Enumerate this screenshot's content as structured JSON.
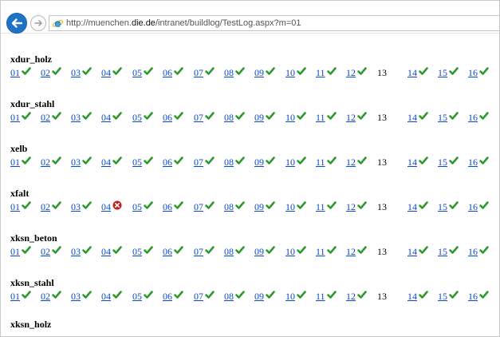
{
  "browser": {
    "url_prefix": "http://muenchen.",
    "url_host": "die.de",
    "url_suffix": "/intranet/buildlog/TestLog.aspx?m=01"
  },
  "groups": [
    {
      "name": "xdur_holz",
      "entries": [
        {
          "label": "01",
          "status": "ok"
        },
        {
          "label": "02",
          "status": "ok"
        },
        {
          "label": "03",
          "status": "ok"
        },
        {
          "label": "04",
          "status": "ok"
        },
        {
          "label": "05",
          "status": "ok"
        },
        {
          "label": "06",
          "status": "ok"
        },
        {
          "label": "07",
          "status": "ok"
        },
        {
          "label": "08",
          "status": "ok"
        },
        {
          "label": "09",
          "status": "ok"
        },
        {
          "label": "10",
          "status": "ok"
        },
        {
          "label": "11",
          "status": "ok"
        },
        {
          "label": "12",
          "status": "ok"
        },
        {
          "label": "13",
          "status": "none"
        },
        {
          "label": "14",
          "status": "ok"
        },
        {
          "label": "15",
          "status": "ok"
        },
        {
          "label": "16",
          "status": "ok"
        }
      ]
    },
    {
      "name": "xdur_stahl",
      "entries": [
        {
          "label": "01",
          "status": "ok"
        },
        {
          "label": "02",
          "status": "ok"
        },
        {
          "label": "03",
          "status": "ok"
        },
        {
          "label": "04",
          "status": "ok"
        },
        {
          "label": "05",
          "status": "ok"
        },
        {
          "label": "06",
          "status": "ok"
        },
        {
          "label": "07",
          "status": "ok"
        },
        {
          "label": "08",
          "status": "ok"
        },
        {
          "label": "09",
          "status": "ok"
        },
        {
          "label": "10",
          "status": "ok"
        },
        {
          "label": "11",
          "status": "ok"
        },
        {
          "label": "12",
          "status": "ok"
        },
        {
          "label": "13",
          "status": "none"
        },
        {
          "label": "14",
          "status": "ok"
        },
        {
          "label": "15",
          "status": "ok"
        },
        {
          "label": "16",
          "status": "ok"
        }
      ]
    },
    {
      "name": "xelb",
      "entries": [
        {
          "label": "01",
          "status": "ok"
        },
        {
          "label": "02",
          "status": "ok"
        },
        {
          "label": "03",
          "status": "ok"
        },
        {
          "label": "04",
          "status": "ok"
        },
        {
          "label": "05",
          "status": "ok"
        },
        {
          "label": "06",
          "status": "ok"
        },
        {
          "label": "07",
          "status": "ok"
        },
        {
          "label": "08",
          "status": "ok"
        },
        {
          "label": "09",
          "status": "ok"
        },
        {
          "label": "10",
          "status": "ok"
        },
        {
          "label": "11",
          "status": "ok"
        },
        {
          "label": "12",
          "status": "ok"
        },
        {
          "label": "13",
          "status": "none"
        },
        {
          "label": "14",
          "status": "ok"
        },
        {
          "label": "15",
          "status": "ok"
        },
        {
          "label": "16",
          "status": "ok"
        }
      ]
    },
    {
      "name": "xfalt",
      "entries": [
        {
          "label": "01",
          "status": "ok"
        },
        {
          "label": "02",
          "status": "ok"
        },
        {
          "label": "03",
          "status": "ok"
        },
        {
          "label": "04",
          "status": "fail"
        },
        {
          "label": "05",
          "status": "ok"
        },
        {
          "label": "06",
          "status": "ok"
        },
        {
          "label": "07",
          "status": "ok"
        },
        {
          "label": "08",
          "status": "ok"
        },
        {
          "label": "09",
          "status": "ok"
        },
        {
          "label": "10",
          "status": "ok"
        },
        {
          "label": "11",
          "status": "ok"
        },
        {
          "label": "12",
          "status": "ok"
        },
        {
          "label": "13",
          "status": "none"
        },
        {
          "label": "14",
          "status": "ok"
        },
        {
          "label": "15",
          "status": "ok"
        },
        {
          "label": "16",
          "status": "ok"
        }
      ]
    },
    {
      "name": "xksn_beton",
      "entries": [
        {
          "label": "01",
          "status": "ok"
        },
        {
          "label": "02",
          "status": "ok"
        },
        {
          "label": "03",
          "status": "ok"
        },
        {
          "label": "04",
          "status": "ok"
        },
        {
          "label": "05",
          "status": "ok"
        },
        {
          "label": "06",
          "status": "ok"
        },
        {
          "label": "07",
          "status": "ok"
        },
        {
          "label": "08",
          "status": "ok"
        },
        {
          "label": "09",
          "status": "ok"
        },
        {
          "label": "10",
          "status": "ok"
        },
        {
          "label": "11",
          "status": "ok"
        },
        {
          "label": "12",
          "status": "ok"
        },
        {
          "label": "13",
          "status": "none"
        },
        {
          "label": "14",
          "status": "ok"
        },
        {
          "label": "15",
          "status": "ok"
        },
        {
          "label": "16",
          "status": "ok"
        }
      ]
    },
    {
      "name": "xksn_stahl",
      "entries": [
        {
          "label": "01",
          "status": "ok"
        },
        {
          "label": "02",
          "status": "ok"
        },
        {
          "label": "03",
          "status": "ok"
        },
        {
          "label": "04",
          "status": "ok"
        },
        {
          "label": "05",
          "status": "ok"
        },
        {
          "label": "06",
          "status": "ok"
        },
        {
          "label": "07",
          "status": "ok"
        },
        {
          "label": "08",
          "status": "ok"
        },
        {
          "label": "09",
          "status": "ok"
        },
        {
          "label": "10",
          "status": "ok"
        },
        {
          "label": "11",
          "status": "ok"
        },
        {
          "label": "12",
          "status": "ok"
        },
        {
          "label": "13",
          "status": "none"
        },
        {
          "label": "14",
          "status": "ok"
        },
        {
          "label": "15",
          "status": "ok"
        },
        {
          "label": "16",
          "status": "ok"
        }
      ]
    },
    {
      "name": "xksn_holz",
      "entries": []
    }
  ],
  "colors": {
    "link": "#0a4ad6",
    "ok": "#2e9a2e",
    "fail": "#c41f1f",
    "back_button": "#1e73c8"
  }
}
